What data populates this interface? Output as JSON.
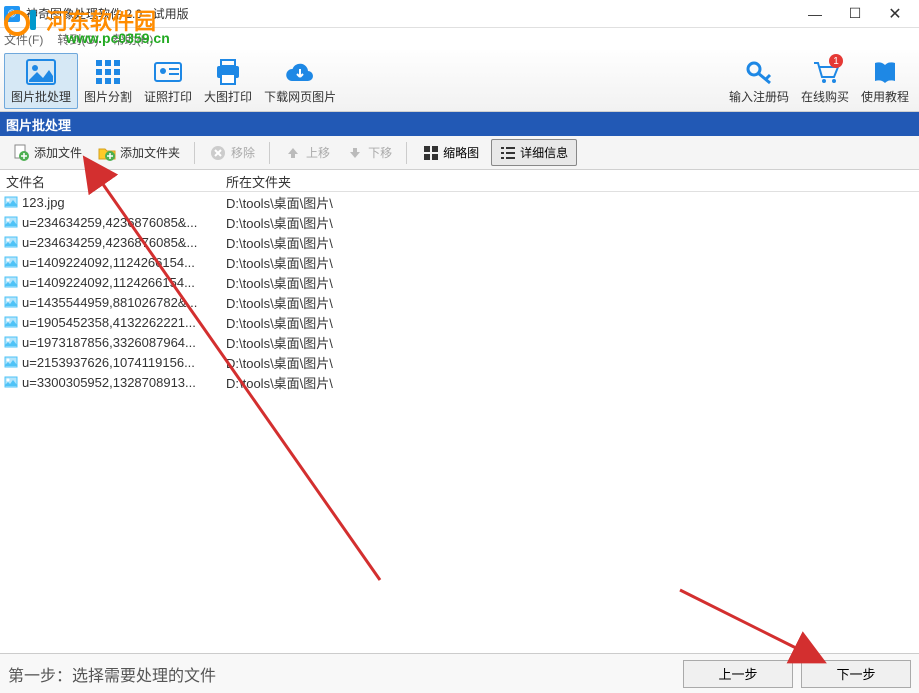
{
  "window": {
    "title": "神奇图像处理软件 2.0 - 试用版"
  },
  "watermark": {
    "text": "河东软件园",
    "url": "www.pc0359.cn"
  },
  "menubar": {
    "file": "文件(F)",
    "goto": "转到(G)",
    "help": "帮助(H)"
  },
  "toolbar": {
    "batch": "图片批处理",
    "split": "图片分割",
    "idprint": "证照打印",
    "bigprint": "大图打印",
    "webdl": "下载网页图片",
    "regcode": "输入注册码",
    "buy": "在线购买",
    "tutorial": "使用教程",
    "cart_badge": "1"
  },
  "section": {
    "title": "图片批处理"
  },
  "subtoolbar": {
    "addfile": "添加文件",
    "addfolder": "添加文件夹",
    "remove": "移除",
    "moveup": "上移",
    "movedown": "下移",
    "thumb": "缩略图",
    "detail": "详细信息"
  },
  "columns": {
    "name": "文件名",
    "folder": "所在文件夹"
  },
  "rows": [
    {
      "name": "123.jpg",
      "folder": "D:\\tools\\桌面\\图片\\"
    },
    {
      "name": "u=234634259,4236876085&...",
      "folder": "D:\\tools\\桌面\\图片\\"
    },
    {
      "name": "u=234634259,4236876085&...",
      "folder": "D:\\tools\\桌面\\图片\\"
    },
    {
      "name": "u=1409224092,1124266154...",
      "folder": "D:\\tools\\桌面\\图片\\"
    },
    {
      "name": "u=1409224092,1124266154...",
      "folder": "D:\\tools\\桌面\\图片\\"
    },
    {
      "name": "u=1435544959,881026782&...",
      "folder": "D:\\tools\\桌面\\图片\\"
    },
    {
      "name": "u=1905452358,4132262221...",
      "folder": "D:\\tools\\桌面\\图片\\"
    },
    {
      "name": "u=1973187856,3326087964...",
      "folder": "D:\\tools\\桌面\\图片\\"
    },
    {
      "name": "u=2153937626,1074119156...",
      "folder": "D:\\tools\\桌面\\图片\\"
    },
    {
      "name": "u=3300305952,1328708913...",
      "folder": "D:\\tools\\桌面\\图片\\"
    }
  ],
  "footer": {
    "step": "第一步：选择需要处理的文件",
    "prev": "上一步",
    "next": "下一步"
  }
}
